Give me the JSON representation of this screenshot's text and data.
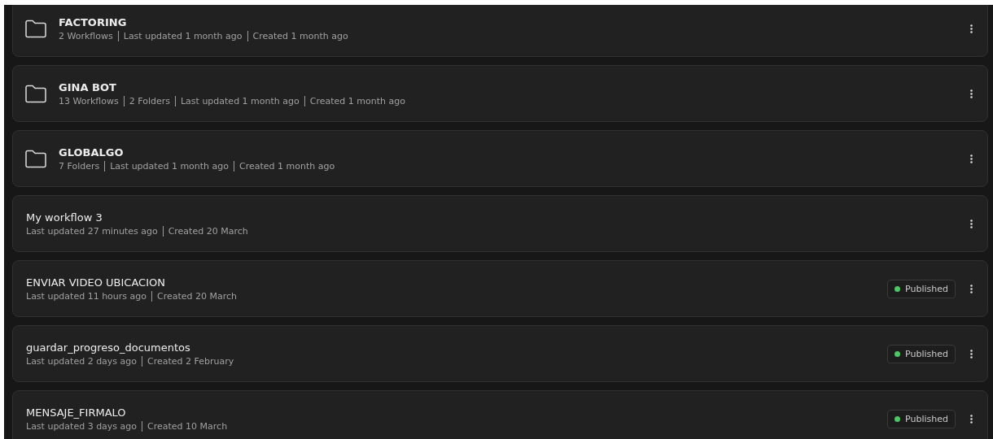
{
  "items": [
    {
      "kind": "folder",
      "name": "FACTORING",
      "meta": [
        "2 Workflows",
        "Last updated 1 month ago",
        "Created 1 month ago"
      ]
    },
    {
      "kind": "folder",
      "name": "GINA BOT",
      "meta": [
        "13 Workflows",
        "2 Folders",
        "Last updated 1 month ago",
        "Created 1 month ago"
      ]
    },
    {
      "kind": "folder",
      "name": "GLOBALGO",
      "meta": [
        "7 Folders",
        "Last updated 1 month ago",
        "Created 1 month ago"
      ]
    },
    {
      "kind": "workflow",
      "name": "My workflow 3",
      "meta": [
        "Last updated 27 minutes ago",
        "Created 20 March"
      ]
    },
    {
      "kind": "workflow",
      "name": "ENVIAR VIDEO UBICACION",
      "meta": [
        "Last updated 11 hours ago",
        "Created 20 March"
      ],
      "status": {
        "label": "Published",
        "color": "#4cc764"
      }
    },
    {
      "kind": "workflow",
      "name": "guardar_progreso_documentos",
      "meta": [
        "Last updated 2 days ago",
        "Created 2 February"
      ],
      "status": {
        "label": "Published",
        "color": "#4cc764"
      }
    },
    {
      "kind": "workflow",
      "name": "MENSAJE_FIRMALO",
      "meta": [
        "Last updated 3 days ago",
        "Created 10 March"
      ],
      "status": {
        "label": "Published",
        "color": "#4cc764"
      }
    }
  ]
}
